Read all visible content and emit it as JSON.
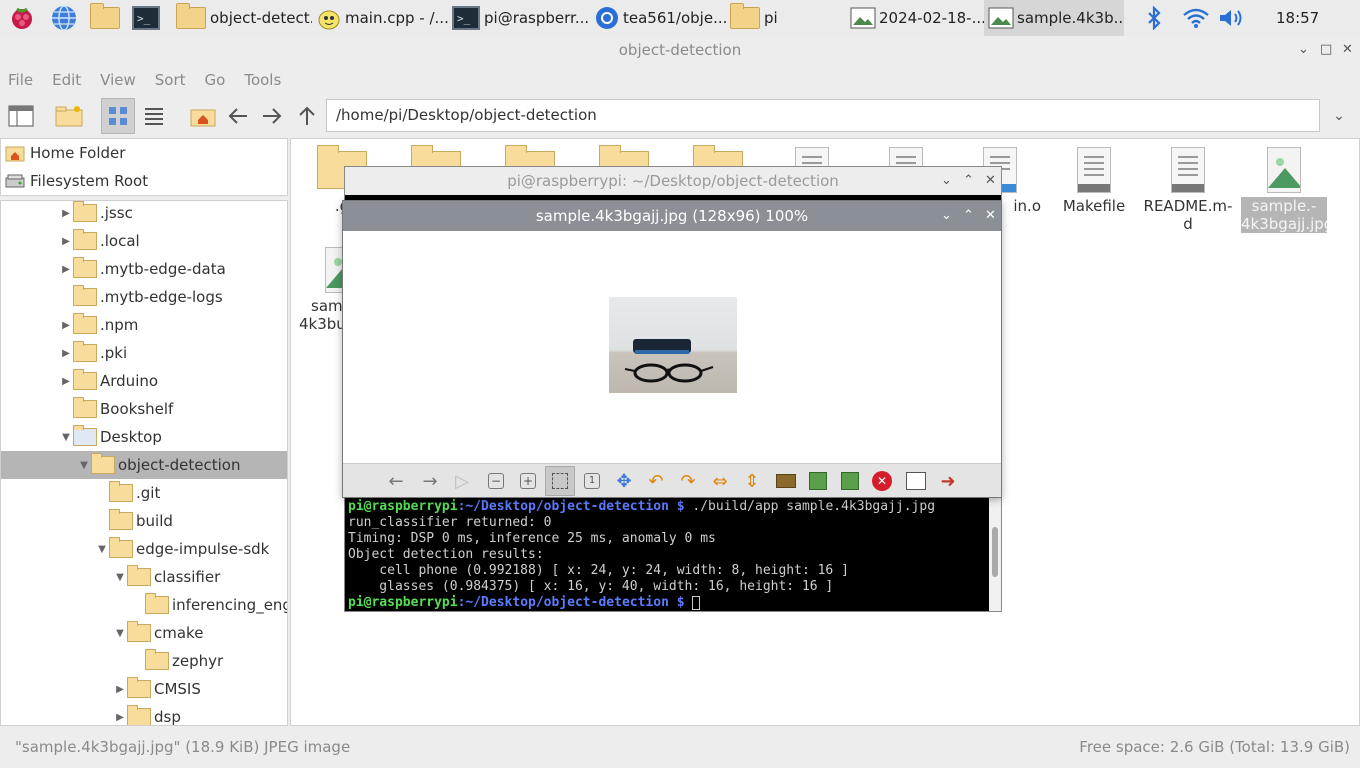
{
  "taskbar": {
    "tasks": [
      {
        "label": "object-detect..."
      },
      {
        "label": "main.cpp - /..."
      },
      {
        "label": "pi@raspberr..."
      },
      {
        "label": "tea561/obje..."
      },
      {
        "label": "pi"
      },
      {
        "label": "2024-02-18-..."
      },
      {
        "label": "sample.4k3b..."
      }
    ],
    "clock": "18:57"
  },
  "window": {
    "title": "object-detection",
    "menu": [
      "File",
      "Edit",
      "View",
      "Sort",
      "Go",
      "Tools"
    ],
    "path": "/home/pi/Desktop/object-detection"
  },
  "places": [
    {
      "label": "Home Folder"
    },
    {
      "label": "Filesystem Root"
    }
  ],
  "tree": [
    {
      "label": ".jssc"
    },
    {
      "label": ".local"
    },
    {
      "label": ".mytb-edge-data"
    },
    {
      "label": ".mytb-edge-logs"
    },
    {
      "label": ".npm"
    },
    {
      "label": ".pki"
    },
    {
      "label": "Arduino"
    },
    {
      "label": "Bookshelf"
    },
    {
      "label": "Desktop"
    },
    {
      "label": "object-detection"
    },
    {
      "label": ".git"
    },
    {
      "label": "build"
    },
    {
      "label": "edge-impulse-sdk"
    },
    {
      "label": "classifier"
    },
    {
      "label": "inferencing_engi"
    },
    {
      "label": "cmake"
    },
    {
      "label": "zephyr"
    },
    {
      "label": "CMSIS"
    },
    {
      "label": "dsp"
    }
  ],
  "files": {
    "partial_left": [
      ".g",
      "sam",
      "4k3bu"
    ],
    "main_o": "in.o",
    "makefile": "Makefile",
    "readme_1": "README.m-",
    "readme_2": "d",
    "sample_1": "sample.-",
    "sample_2": "4k3bgajj.jpg"
  },
  "status": {
    "left": "\"sample.4k3bgajj.jpg\" (18.9 KiB) JPEG image",
    "right": "Free space: 2.6 GiB (Total: 13.9 GiB)"
  },
  "terminal": {
    "title": "pi@raspberrypi: ~/Desktop/object-detection",
    "prompt_user": "pi@raspberrypi",
    "prompt_path": ":~/Desktop/object-detection $",
    "command": " ./build/app sample.4k3bgajj.jpg",
    "lines": [
      "run_classifier returned: 0",
      "Timing: DSP 0 ms, inference 25 ms, anomaly 0 ms",
      "Object detection results:",
      "    cell phone (0.992188) [ x: 24, y: 24, width: 8, height: 16 ]",
      "    glasses (0.984375) [ x: 16, y: 40, width: 16, height: 16 ]"
    ]
  },
  "viewer": {
    "title": "sample.4k3bgajj.jpg (128x96) 100%"
  },
  "colors": {
    "selection": "#b5b5b5",
    "viewer_titlebar": "#8b9096",
    "prompt_green": "#55e055",
    "prompt_blue": "#5c7cff"
  }
}
